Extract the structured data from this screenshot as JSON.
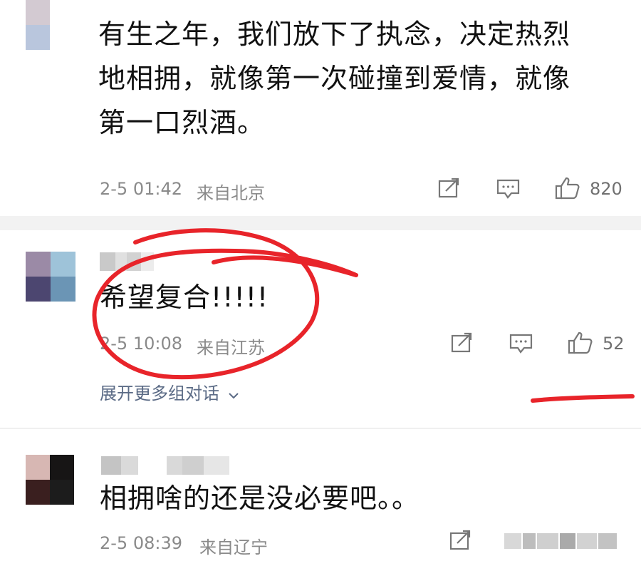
{
  "comments": [
    {
      "text_lines": [
        "有生之年，我们放下了执念，决定热烈",
        "地相拥，就像第一次碰撞到爱情，就像",
        "第一口烈酒。"
      ],
      "time": "2-5 01:42",
      "location": "来自北京",
      "like_count": "820",
      "avatar_colors": [
        "#d3cad2",
        "#ffffff",
        "#b9c6dd",
        "#ffffff"
      ]
    },
    {
      "text_lines": [
        "希望复合!!!!!"
      ],
      "time": "2-5 10:08",
      "location": "来自江苏",
      "like_count": "52",
      "avatar_colors": [
        "#9b8aa6",
        "#9ec3d9",
        "#4c4670",
        "#6b95b5"
      ],
      "expand_label": "展开更多组对话",
      "expand_icon": "chevron-down-icon"
    },
    {
      "text_lines": [
        "相拥啥的还是没必要吧。。"
      ],
      "time": "2-5 08:39",
      "location": "来自辽宁",
      "avatar_colors": [
        "#d7b7b3",
        "#171515",
        "#3a1f1f",
        "#1c1c1c"
      ]
    }
  ],
  "icons": [
    "share-icon",
    "reply-icon",
    "thumbs-up-icon"
  ],
  "annotation_color": "#e8242a"
}
